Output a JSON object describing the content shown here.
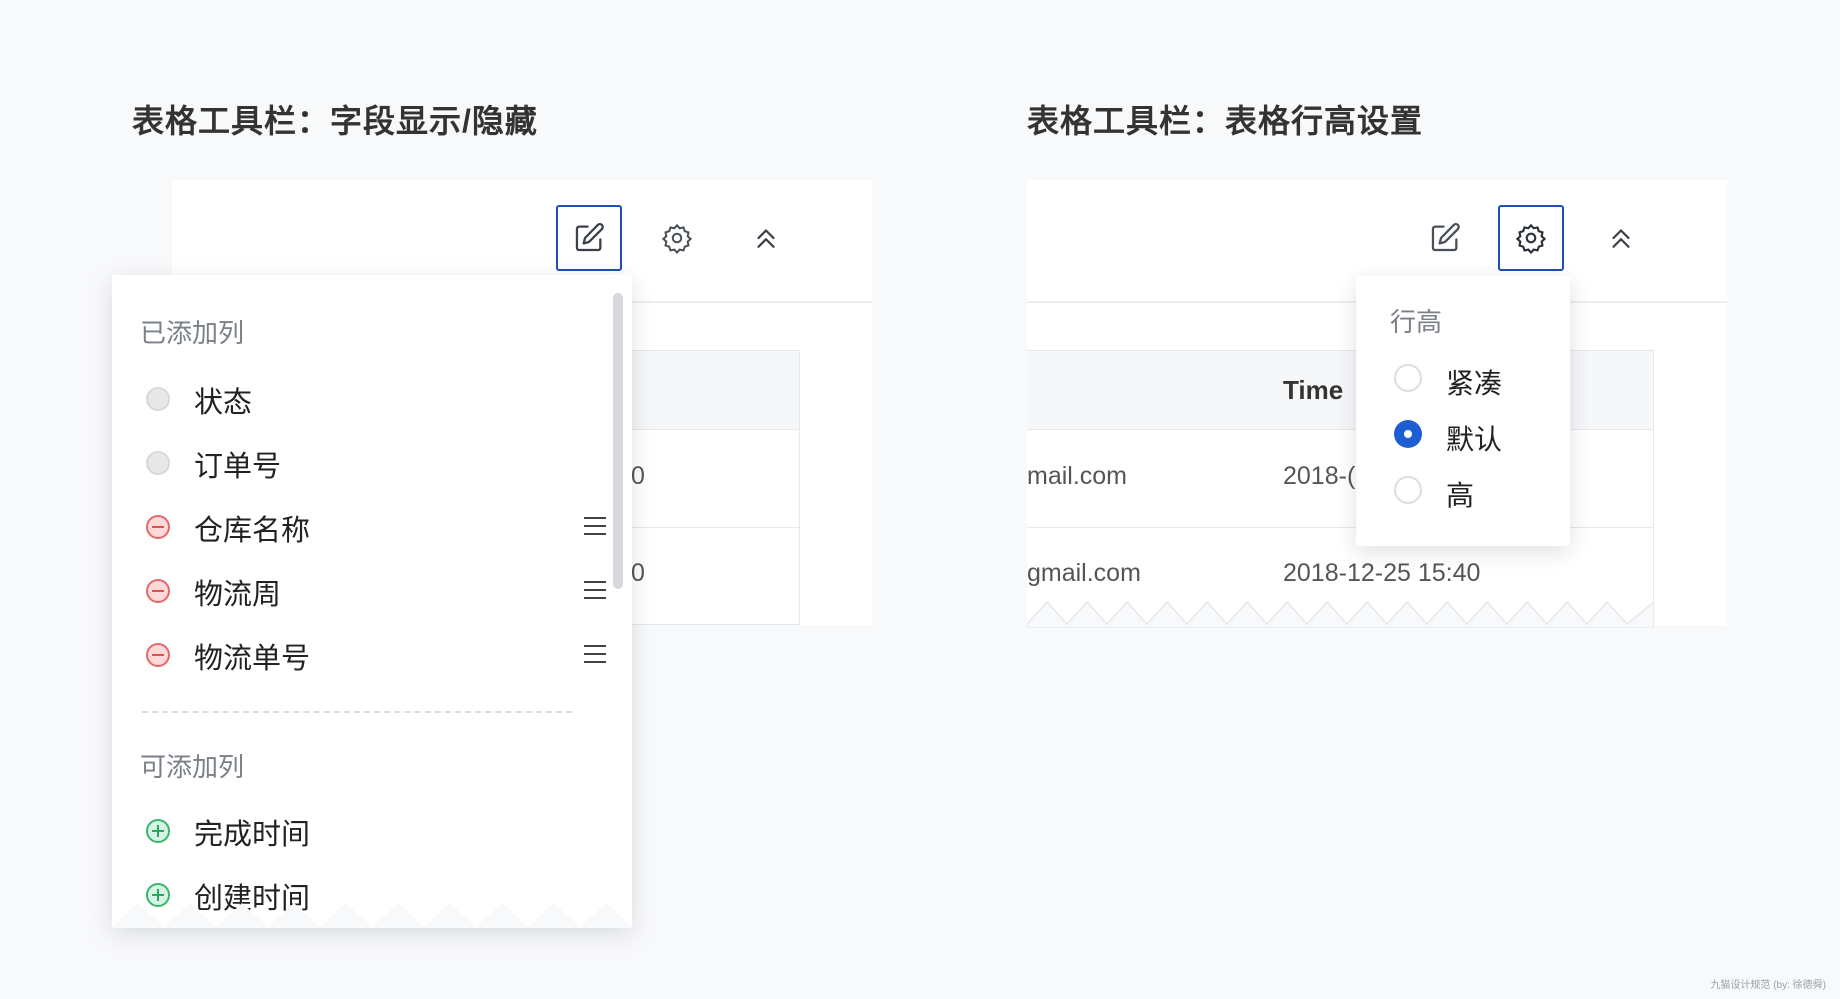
{
  "left_section": {
    "title": "表格工具栏：字段显示/隐藏",
    "toolbar": {
      "icons": [
        "edit-icon",
        "gear-icon",
        "chevrons-up-icon"
      ],
      "active": "edit-icon"
    },
    "table_cells": {
      "row1": "0",
      "row2": "0"
    },
    "column_panel": {
      "added_label": "已添加列",
      "added": [
        {
          "label": "状态",
          "state": "locked"
        },
        {
          "label": "订单号",
          "state": "locked"
        },
        {
          "label": "仓库名称",
          "state": "removable",
          "draggable": true
        },
        {
          "label": "物流周",
          "state": "removable",
          "draggable": true
        },
        {
          "label": "物流单号",
          "state": "removable",
          "draggable": true
        }
      ],
      "available_label": "可添加列",
      "available": [
        {
          "label": "完成时间",
          "state": "addable"
        },
        {
          "label": "创建时间",
          "state": "addable"
        }
      ]
    }
  },
  "right_section": {
    "title": "表格工具栏：表格行高设置",
    "toolbar": {
      "icons": [
        "edit-icon",
        "gear-icon",
        "chevrons-up-icon"
      ],
      "active": "gear-icon"
    },
    "table": {
      "header_time": "Time",
      "rows": [
        {
          "email": "mail.com",
          "time": "2018-("
        },
        {
          "email": "gmail.com",
          "time": "2018-12-25  15:40"
        }
      ]
    },
    "row_height_panel": {
      "title": "行高",
      "options": [
        {
          "label": "紧凑",
          "checked": false
        },
        {
          "label": "默认",
          "checked": true
        },
        {
          "label": "高",
          "checked": false
        }
      ]
    }
  },
  "colors": {
    "accent": "#1c4fb8",
    "remove": "#e86868",
    "add": "#35b86d",
    "radio": "#1d5fd0"
  },
  "watermark": "九猫设计规范 (by: 徐德舜)"
}
